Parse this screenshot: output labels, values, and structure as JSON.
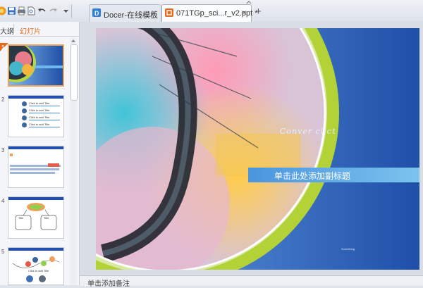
{
  "tabs": [
    {
      "label": "Docer-在线模板",
      "active": false
    },
    {
      "label": "071TGp_sci...r_v2.ppt *",
      "active": true
    }
  ],
  "new_tab_label": "+",
  "close_glyph": "×",
  "left_pane": {
    "tabs": [
      "大纲",
      "幻灯片"
    ],
    "active_tab": "幻灯片",
    "slide_numbers": [
      "1",
      "2",
      "3",
      "4",
      "5"
    ],
    "thumb2_items": [
      "Click to add Title",
      "Click to add Title",
      "Click to add Title",
      "Click to add Title"
    ],
    "thumb4_items": [
      "Title",
      "Title"
    ],
    "thumb5_items": [
      "Click to add Title"
    ]
  },
  "slide": {
    "title_placeholder": "Conver clict",
    "subtitle_placeholder": "单击此处添加副标题",
    "small_text": "Something"
  },
  "notes_placeholder": "单击添加备注",
  "colors": {
    "accent_orange": "#e66b1f",
    "slide_blue": "#1f4fa8",
    "subtitle_bar": "#5fa9e6",
    "lime": "#a6d22f"
  }
}
